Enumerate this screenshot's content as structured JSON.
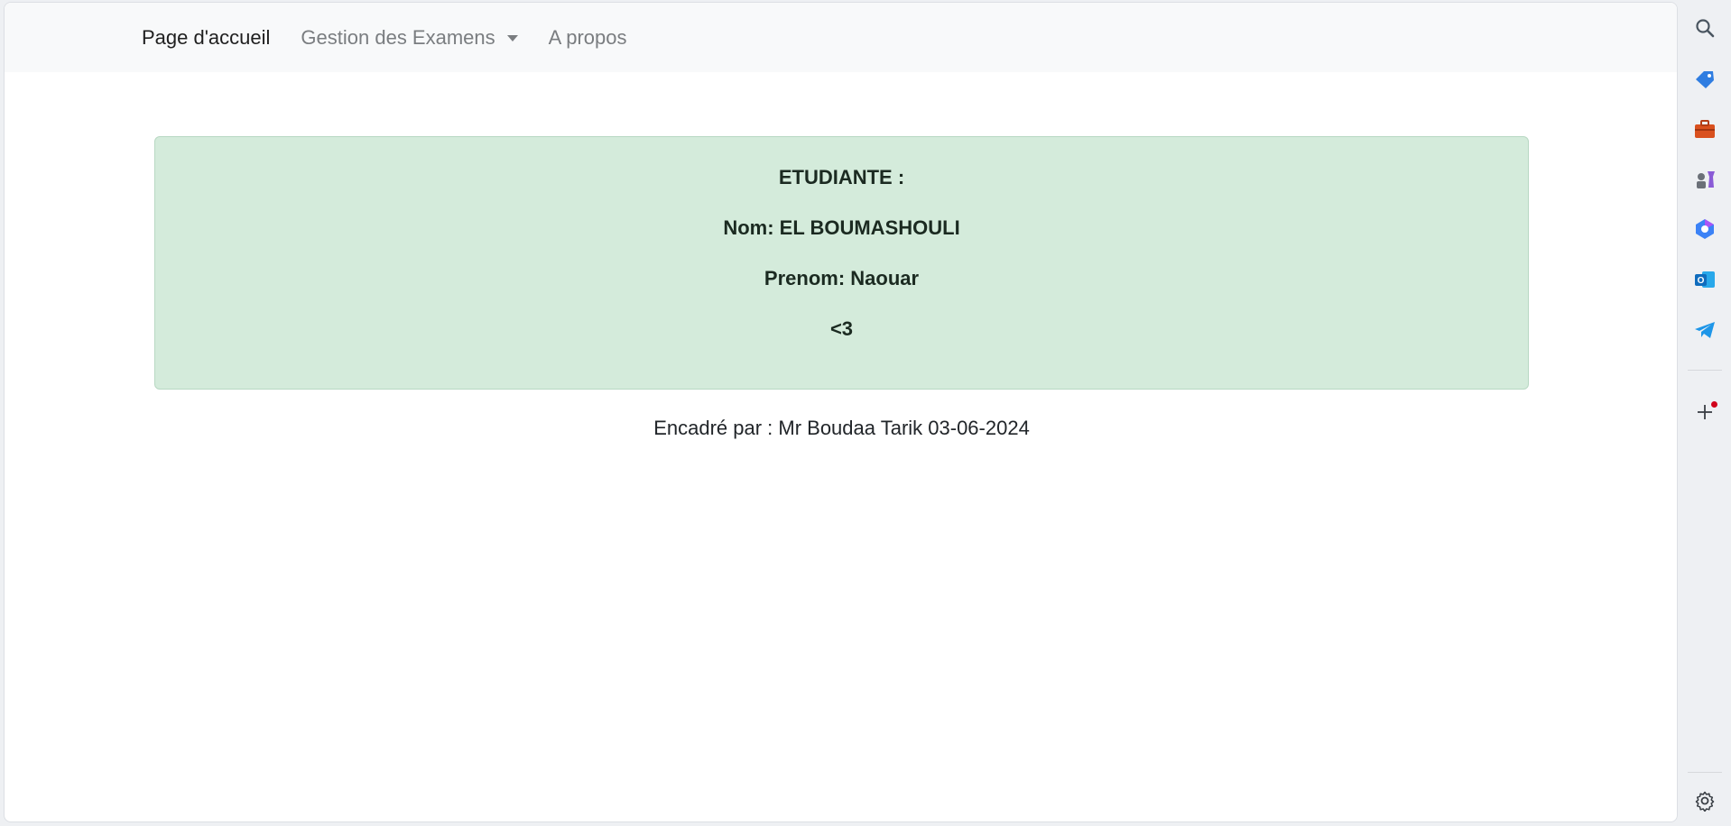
{
  "navbar": {
    "home": "Page d'accueil",
    "exams": "Gestion des Examens",
    "about": "A propos"
  },
  "alert": {
    "line1": "ETUDIANTE :",
    "line2": "Nom: EL BOUMASHOULI",
    "line3": "Prenom: Naouar",
    "line4": "<3"
  },
  "footer": {
    "text": "Encadré par : Mr Boudaa Tarik 03-06-2024"
  },
  "sidebar": {
    "icons": [
      "search-icon",
      "tag-icon",
      "briefcase-icon",
      "chess-icon",
      "copilot-icon",
      "outlook-icon",
      "telegram-icon",
      "add-icon",
      "settings-icon"
    ]
  },
  "colors": {
    "alert_bg": "#d4ebdb",
    "navbar_bg": "#f8f9fa",
    "notification_dot": "#d0021b"
  }
}
